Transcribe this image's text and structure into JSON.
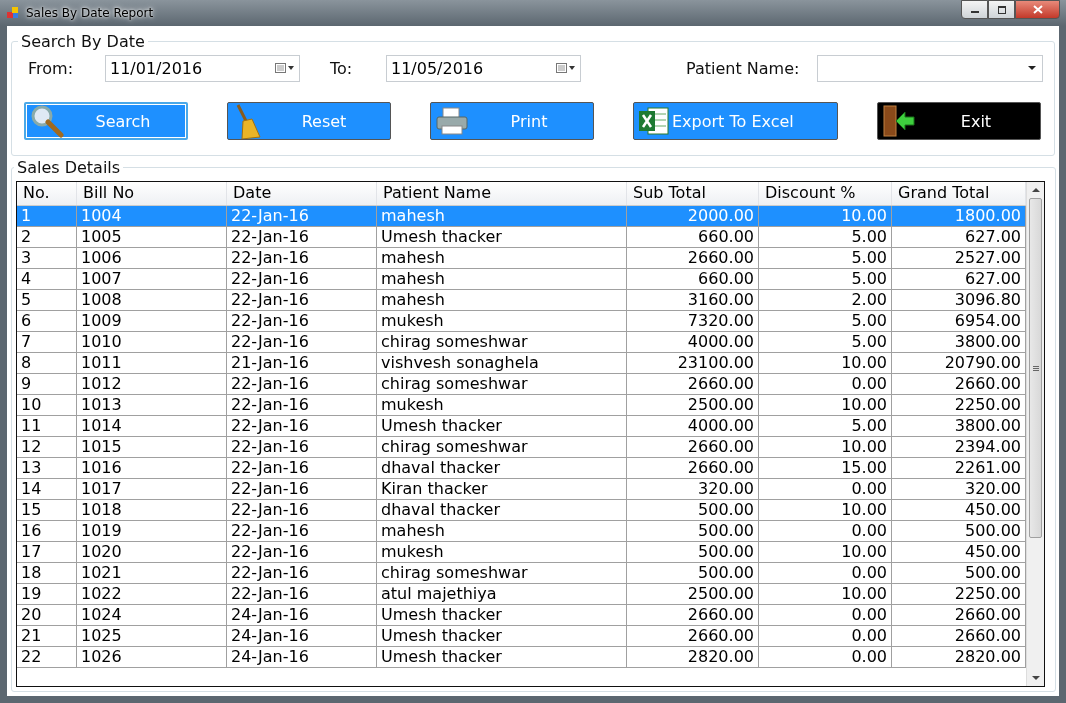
{
  "window": {
    "title": "Sales By Date Report"
  },
  "search_group": {
    "title": "Search By Date",
    "from": {
      "label": "From:",
      "value": "11/01/2016"
    },
    "to": {
      "label": "To:",
      "value": "11/05/2016"
    },
    "patient": {
      "label": "Patient Name:"
    },
    "buttons": [
      {
        "label": "Search",
        "kind": "blue",
        "focused": true
      },
      {
        "label": "Reset",
        "kind": "blue",
        "focused": false
      },
      {
        "label": "Print",
        "kind": "blue",
        "focused": false
      },
      {
        "label": "Export To Excel",
        "kind": "blue",
        "focused": false
      },
      {
        "label": "Exit",
        "kind": "dark",
        "focused": false
      }
    ]
  },
  "details_group": {
    "title": "Sales Details",
    "table": {
      "columns": [
        "No.",
        "Bill No",
        "Date",
        "Patient Name",
        "Sub Total",
        "Discount %",
        "Grand Total"
      ],
      "rows": [
        {
          "selected": true,
          "cells": [
            "1",
            "1004",
            "22-Jan-16",
            "mahesh",
            "2000.00",
            "10.00",
            "1800.00"
          ]
        },
        {
          "selected": false,
          "cells": [
            "2",
            "1005",
            "22-Jan-16",
            "Umesh thacker",
            "660.00",
            "5.00",
            "627.00"
          ]
        },
        {
          "selected": false,
          "cells": [
            "3",
            "1006",
            "22-Jan-16",
            "mahesh",
            "2660.00",
            "5.00",
            "2527.00"
          ]
        },
        {
          "selected": false,
          "cells": [
            "4",
            "1007",
            "22-Jan-16",
            "mahesh",
            "660.00",
            "5.00",
            "627.00"
          ]
        },
        {
          "selected": false,
          "cells": [
            "5",
            "1008",
            "22-Jan-16",
            "mahesh",
            "3160.00",
            "2.00",
            "3096.80"
          ]
        },
        {
          "selected": false,
          "cells": [
            "6",
            "1009",
            "22-Jan-16",
            "mukesh",
            "7320.00",
            "5.00",
            "6954.00"
          ]
        },
        {
          "selected": false,
          "cells": [
            "7",
            "1010",
            "22-Jan-16",
            "chirag someshwar",
            "4000.00",
            "5.00",
            "3800.00"
          ]
        },
        {
          "selected": false,
          "cells": [
            "8",
            "1011",
            "21-Jan-16",
            "vishvesh sonaghela",
            "23100.00",
            "10.00",
            "20790.00"
          ]
        },
        {
          "selected": false,
          "cells": [
            "9",
            "1012",
            "22-Jan-16",
            "chirag someshwar",
            "2660.00",
            "0.00",
            "2660.00"
          ]
        },
        {
          "selected": false,
          "cells": [
            "10",
            "1013",
            "22-Jan-16",
            "mukesh",
            "2500.00",
            "10.00",
            "2250.00"
          ]
        },
        {
          "selected": false,
          "cells": [
            "11",
            "1014",
            "22-Jan-16",
            "Umesh thacker",
            "4000.00",
            "5.00",
            "3800.00"
          ]
        },
        {
          "selected": false,
          "cells": [
            "12",
            "1015",
            "22-Jan-16",
            "chirag someshwar",
            "2660.00",
            "10.00",
            "2394.00"
          ]
        },
        {
          "selected": false,
          "cells": [
            "13",
            "1016",
            "22-Jan-16",
            "dhaval thacker",
            "2660.00",
            "15.00",
            "2261.00"
          ]
        },
        {
          "selected": false,
          "cells": [
            "14",
            "1017",
            "22-Jan-16",
            "Kiran thacker",
            "320.00",
            "0.00",
            "320.00"
          ]
        },
        {
          "selected": false,
          "cells": [
            "15",
            "1018",
            "22-Jan-16",
            "dhaval thacker",
            "500.00",
            "10.00",
            "450.00"
          ]
        },
        {
          "selected": false,
          "cells": [
            "16",
            "1019",
            "22-Jan-16",
            "mahesh",
            "500.00",
            "0.00",
            "500.00"
          ]
        },
        {
          "selected": false,
          "cells": [
            "17",
            "1020",
            "22-Jan-16",
            "mukesh",
            "500.00",
            "10.00",
            "450.00"
          ]
        },
        {
          "selected": false,
          "cells": [
            "18",
            "1021",
            "22-Jan-16",
            "chirag someshwar",
            "500.00",
            "0.00",
            "500.00"
          ]
        },
        {
          "selected": false,
          "cells": [
            "19",
            "1022",
            "22-Jan-16",
            "atul majethiya",
            "2500.00",
            "10.00",
            "2250.00"
          ]
        },
        {
          "selected": false,
          "cells": [
            "20",
            "1024",
            "24-Jan-16",
            "Umesh thacker",
            "2660.00",
            "0.00",
            "2660.00"
          ]
        },
        {
          "selected": false,
          "cells": [
            "21",
            "1025",
            "24-Jan-16",
            "Umesh thacker",
            "2660.00",
            "0.00",
            "2660.00"
          ]
        },
        {
          "selected": false,
          "cells": [
            "22",
            "1026",
            "24-Jan-16",
            "Umesh thacker",
            "2820.00",
            "0.00",
            "2820.00"
          ]
        }
      ]
    }
  }
}
